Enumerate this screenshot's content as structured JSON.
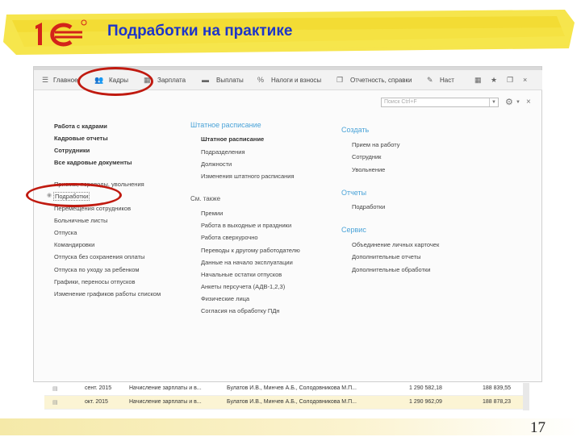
{
  "slide": {
    "title": "Подработки на практике",
    "page_number": "17",
    "accent": "#1d35c9",
    "highlight": "#f5e23a",
    "annotation_color": "#c01a10"
  },
  "toolbar": {
    "items": [
      {
        "label": "Главное",
        "icon": "menu-icon"
      },
      {
        "label": "Кадры",
        "icon": "people-icon"
      },
      {
        "label": "Зарплата",
        "icon": "calculator-icon"
      },
      {
        "label": "Выплаты",
        "icon": "money-icon"
      },
      {
        "label": "Налоги и взносы",
        "icon": "percent-icon"
      },
      {
        "label": "Отчетность, справки",
        "icon": "report-icon"
      },
      {
        "label": "Наст",
        "icon": "wrench-icon"
      }
    ]
  },
  "search": {
    "placeholder": "Поиск Ctrl+F"
  },
  "col1": {
    "items": [
      "Работа с кадрами",
      "Кадровые отчеты",
      "Сотрудники",
      "Все кадровые документы"
    ],
    "group": [
      "Приемы, переводы, увольнения",
      "Подработки",
      "Перемещения сотрудников",
      "Больничные листы",
      "Отпуска",
      "Командировки",
      "Отпуска без сохранения оплаты",
      "Отпуска по уходу за ребенком",
      "Графики, переносы отпусков",
      "Изменение графиков работы списком"
    ]
  },
  "col2": {
    "title": "Штатное расписание",
    "items": [
      "Штатное расписание",
      "Подразделения",
      "Должности",
      "Изменения штатного расписания"
    ],
    "see_also": "См. также",
    "see_items": [
      "Премии",
      "Работа в выходные и праздники",
      "Работа сверхурочно",
      "Переводы к другому работодателю",
      "Данные на начало эксплуатации",
      "Начальные остатки отпусков",
      "Анкеты персучета (АДВ-1,2,3)",
      "Физические лица",
      "Согласия на обработку ПДн"
    ]
  },
  "col3": {
    "create": "Создать",
    "create_items": [
      "Прием на работу",
      "Сотрудник",
      "Увольнение"
    ],
    "reports": "Отчеты",
    "report_items": [
      "Подработки"
    ],
    "service": "Сервис",
    "service_items": [
      "Объединение личных карточек",
      "Дополнительные отчеты",
      "Дополнительные обработки"
    ]
  },
  "table": {
    "rows": [
      {
        "month": "сент. 2015",
        "doc": "Начисление зарплаты и в...",
        "people": "Булатов И.В., Минчев А.Б., Солодовникова М.П...",
        "sum": "1 290 582,18",
        "tax": "188 839,55"
      },
      {
        "month": "окт. 2015",
        "doc": "Начисление зарплаты и в...",
        "people": "Булатов И.В., Минчев А.Б., Солодовникова М.П...",
        "sum": "1 290 962,09",
        "tax": "188 878,23"
      }
    ]
  }
}
